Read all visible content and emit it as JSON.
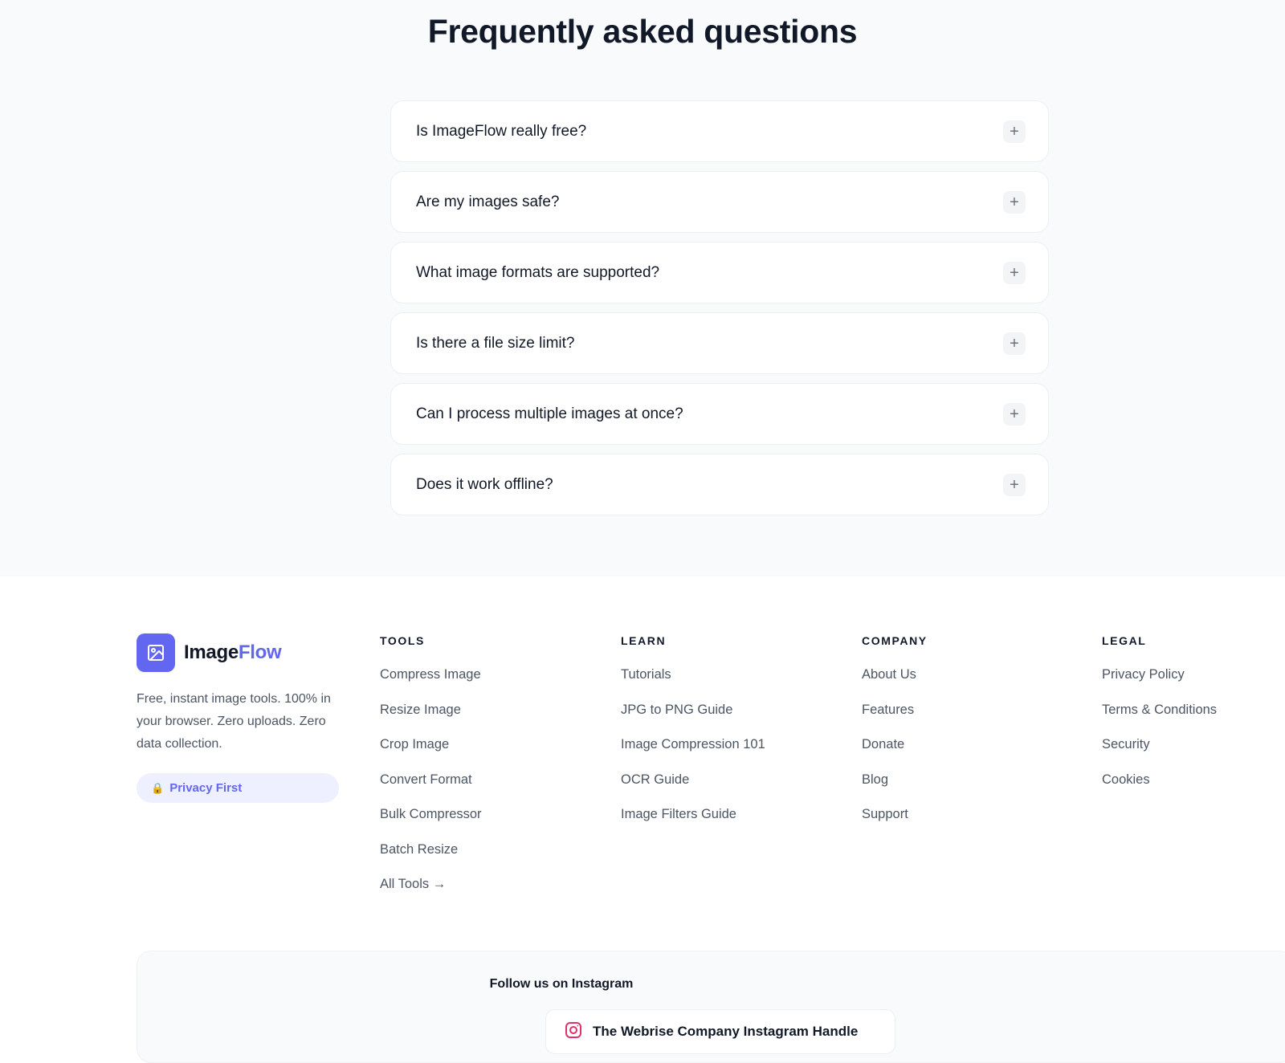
{
  "faq": {
    "title": "Frequently asked questions",
    "items": [
      {
        "question": "Is ImageFlow really free?",
        "toggle": "+"
      },
      {
        "question": "Are my images safe?",
        "toggle": "+"
      },
      {
        "question": "What image formats are supported?",
        "toggle": "+"
      },
      {
        "question": "Is there a file size limit?",
        "toggle": "+"
      },
      {
        "question": "Can I process multiple images at once?",
        "toggle": "+"
      },
      {
        "question": "Does it work offline?",
        "toggle": "+"
      }
    ]
  },
  "footer": {
    "brand": {
      "name_part1": "Image",
      "name_part2": "Flow",
      "description": "Free, instant image tools. 100% in your browser. Zero uploads. Zero data collection.",
      "badge_icon": "🔒",
      "badge_label": "Privacy First",
      "logo_icon": "image-icon"
    },
    "columns": {
      "tools": {
        "title": "TOOLS",
        "links": [
          "Compress Image",
          "Resize Image",
          "Crop Image",
          "Convert Format",
          "Bulk Compressor",
          "Batch Resize",
          "All Tools →"
        ]
      },
      "learn": {
        "title": "LEARN",
        "links": [
          "Tutorials",
          "JPG to PNG Guide",
          "Image Compression 101",
          "OCR Guide",
          "Image Filters Guide"
        ]
      },
      "company": {
        "title": "COMPANY",
        "links": [
          "About Us",
          "Features",
          "Donate",
          "Blog",
          "Support"
        ]
      },
      "legal": {
        "title": "LEGAL",
        "links": [
          "Privacy Policy",
          "Terms & Conditions",
          "Security",
          "Cookies"
        ]
      }
    },
    "instagram": {
      "title": "Follow us on Instagram",
      "button_label": "The Webrise Company Instagram Handle",
      "icon": "instagram-icon"
    }
  },
  "colors": {
    "accent": "#6366f1",
    "instagram": "#e1306c",
    "badge_bg": "#eef0ff",
    "page_bg": "#f9fafb"
  }
}
